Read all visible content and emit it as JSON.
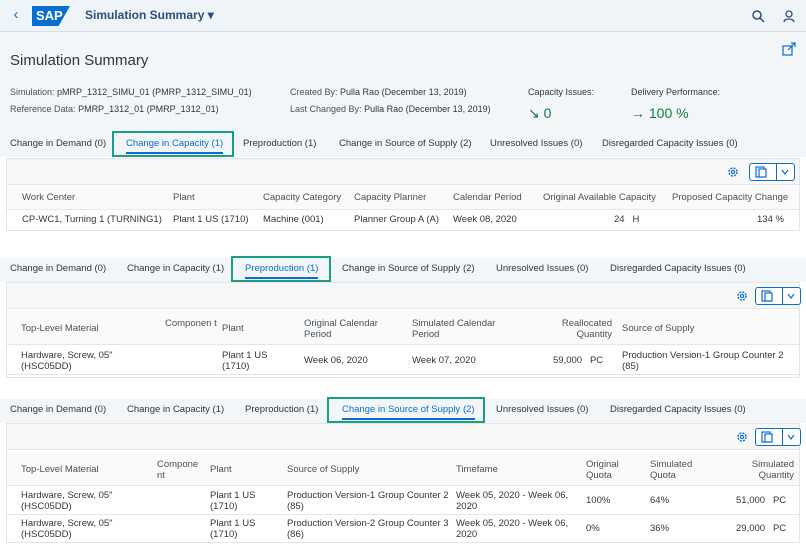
{
  "shell": {
    "title": "Simulation Summary",
    "logo_text": "SAP",
    "icons": [
      "back-icon",
      "search-icon",
      "user-icon"
    ]
  },
  "header": {
    "title": "Simulation Summary",
    "simulation_label": "Simulation:",
    "simulation_value": "pMRP_1312_SIMU_01 (PMRP_1312_SIMU_01)",
    "reference_label": "Reference Data:",
    "reference_value": "PMRP_1312_01 (PMRP_1312_01)",
    "created_label": "Created By:",
    "created_value": "Pulla Rao (December 13, 2019)",
    "changed_label": "Last Changed By:",
    "changed_value": "Pulla Rao (December 13, 2019)",
    "capacity_label": "Capacity Issues:",
    "capacity_value": "↘ 0",
    "delivery_label": "Delivery Performance:",
    "delivery_value": "→ 100 %"
  },
  "tabs": [
    "Change in Demand (0)",
    "Change in Capacity (1)",
    "Preproduction (1)",
    "Change in Source of Supply (2)",
    "Unresolved Issues (0)",
    "Disregarded Capacity Issues (0)"
  ],
  "capacity_table": {
    "columns": [
      "Work Center",
      "Plant",
      "Capacity Category",
      "Capacity Planner",
      "Calendar Period",
      "Original Available Capacity",
      "Proposed Capacity Change"
    ],
    "rows": [
      [
        "CP-WC1, Turning 1 (TURNING1)",
        "Plant 1 US (1710)",
        "Machine (001)",
        "Planner Group A (A)",
        "Week 08, 2020",
        "24   H",
        "134 %"
      ]
    ]
  },
  "preproduction_table": {
    "columns": [
      "Top-Level Material",
      "Componen t",
      "Plant",
      "Original Calendar Period",
      "Simulated Calendar Period",
      "Reallocated Quantity",
      "Source of Supply"
    ],
    "rows": [
      [
        "Hardware, Screw, 05\" (HSC05DD)",
        "",
        "Plant 1 US (1710)",
        "Week 06, 2020",
        "Week 07, 2020",
        "59,000   PC",
        "Production Version-1 Group Counter 2 (85)"
      ]
    ]
  },
  "supply_table": {
    "columns": [
      "Top-Level Material",
      "Compone nt",
      "Plant",
      "Source of Supply",
      "Timefame",
      "Original Quota",
      "Simulated Quota",
      "Simulated Quantity"
    ],
    "rows": [
      [
        "Hardware, Screw, 05\" (HSC05DD)",
        "",
        "Plant 1 US (1710)",
        "Production Version-1 Group Counter 2 (85)",
        "Week 05, 2020 - Week 06, 2020",
        "100%",
        "64%",
        "51,000   PC"
      ],
      [
        "Hardware, Screw, 05\" (HSC05DD)",
        "",
        "Plant 1 US (1710)",
        "Production Version-2 Group Counter 3 (86)",
        "Week 05, 2020 - Week 06, 2020",
        "0%",
        "36%",
        "29,000   PC"
      ]
    ]
  },
  "colors": {
    "accent": "#0a6ed1",
    "highlight": "#1b9d86",
    "positive": "#107e3e"
  }
}
